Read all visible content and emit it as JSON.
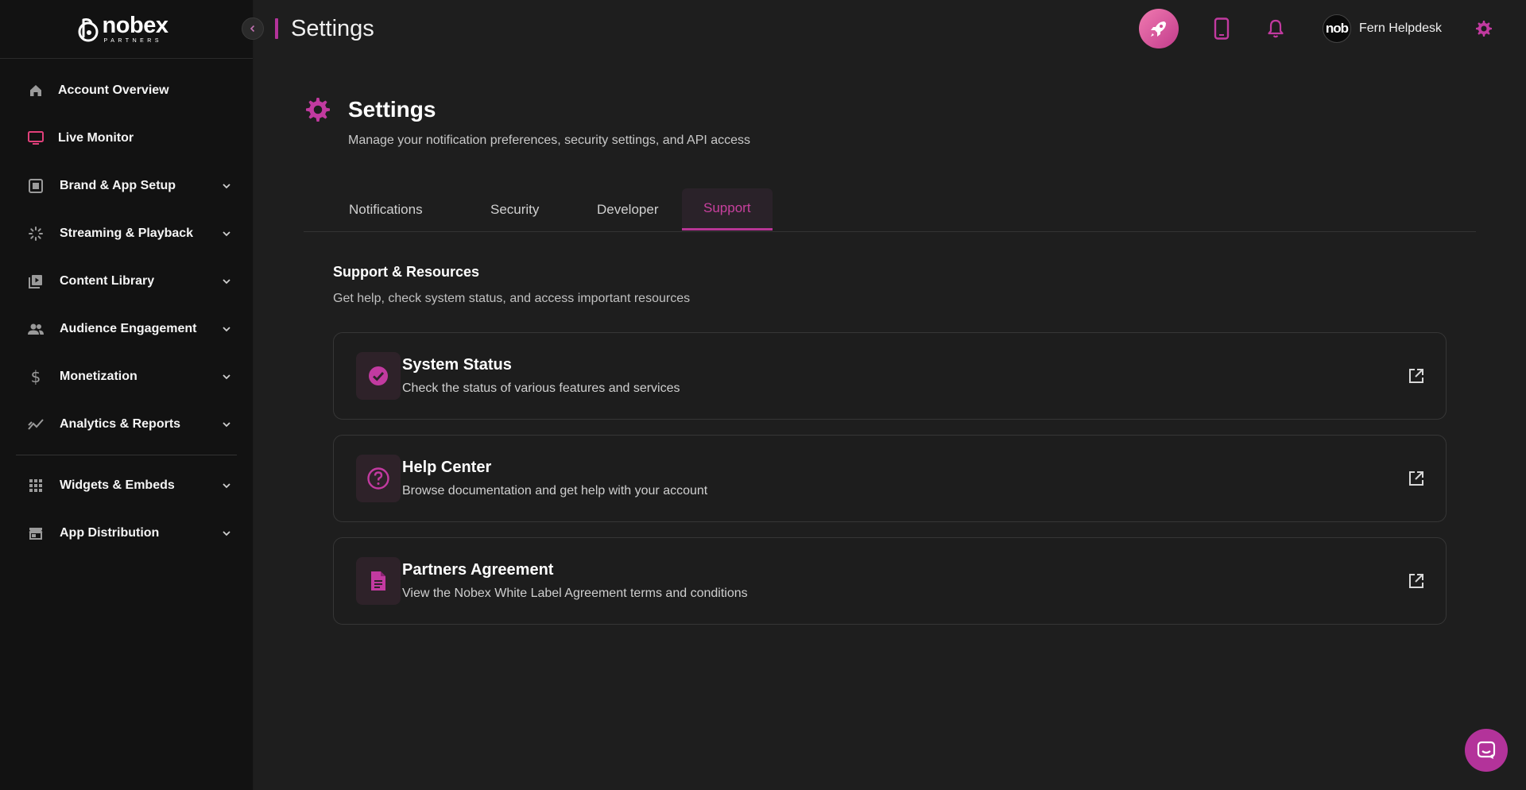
{
  "brand": {
    "name": "nobex",
    "sub": "PARTNERS"
  },
  "sidebar": {
    "items": [
      {
        "label": "Account Overview",
        "icon": "home-icon",
        "chevron": false
      },
      {
        "label": "Live Monitor",
        "icon": "monitor-icon",
        "chevron": false
      },
      {
        "label": "Brand & App Setup",
        "icon": "brand-icon",
        "chevron": true
      },
      {
        "label": "Streaming & Playback",
        "icon": "streaming-icon",
        "chevron": true
      },
      {
        "label": "Content Library",
        "icon": "library-icon",
        "chevron": true
      },
      {
        "label": "Audience Engagement",
        "icon": "people-icon",
        "chevron": true
      },
      {
        "label": "Monetization",
        "icon": "dollar-icon",
        "chevron": true
      },
      {
        "label": "Analytics & Reports",
        "icon": "analytics-icon",
        "chevron": true
      },
      {
        "label": "Widgets & Embeds",
        "icon": "grid-icon",
        "chevron": true
      },
      {
        "label": "App Distribution",
        "icon": "store-icon",
        "chevron": true
      }
    ]
  },
  "header": {
    "title": "Settings",
    "user_name": "Fern Helpdesk",
    "avatar_text": "nob"
  },
  "page": {
    "title": "Settings",
    "subtitle": "Manage your notification preferences, security settings, and API access"
  },
  "tabs": [
    {
      "label": "Notifications",
      "active": false
    },
    {
      "label": "Security",
      "active": false
    },
    {
      "label": "Developer",
      "active": false
    },
    {
      "label": "Support",
      "active": true
    }
  ],
  "support": {
    "title": "Support & Resources",
    "subtitle": "Get help, check system status, and access important resources",
    "cards": [
      {
        "title": "System Status",
        "description": "Check the status of various features and services",
        "icon": "check-circle-icon"
      },
      {
        "title": "Help Center",
        "description": "Browse documentation and get help with your account",
        "icon": "help-circle-icon"
      },
      {
        "title": "Partners Agreement",
        "description": "View the Nobex White Label Agreement terms and conditions",
        "icon": "document-icon"
      }
    ]
  },
  "colors": {
    "accent": "#b3339a",
    "background": "#1e1e1e",
    "sidebar": "#121212"
  }
}
